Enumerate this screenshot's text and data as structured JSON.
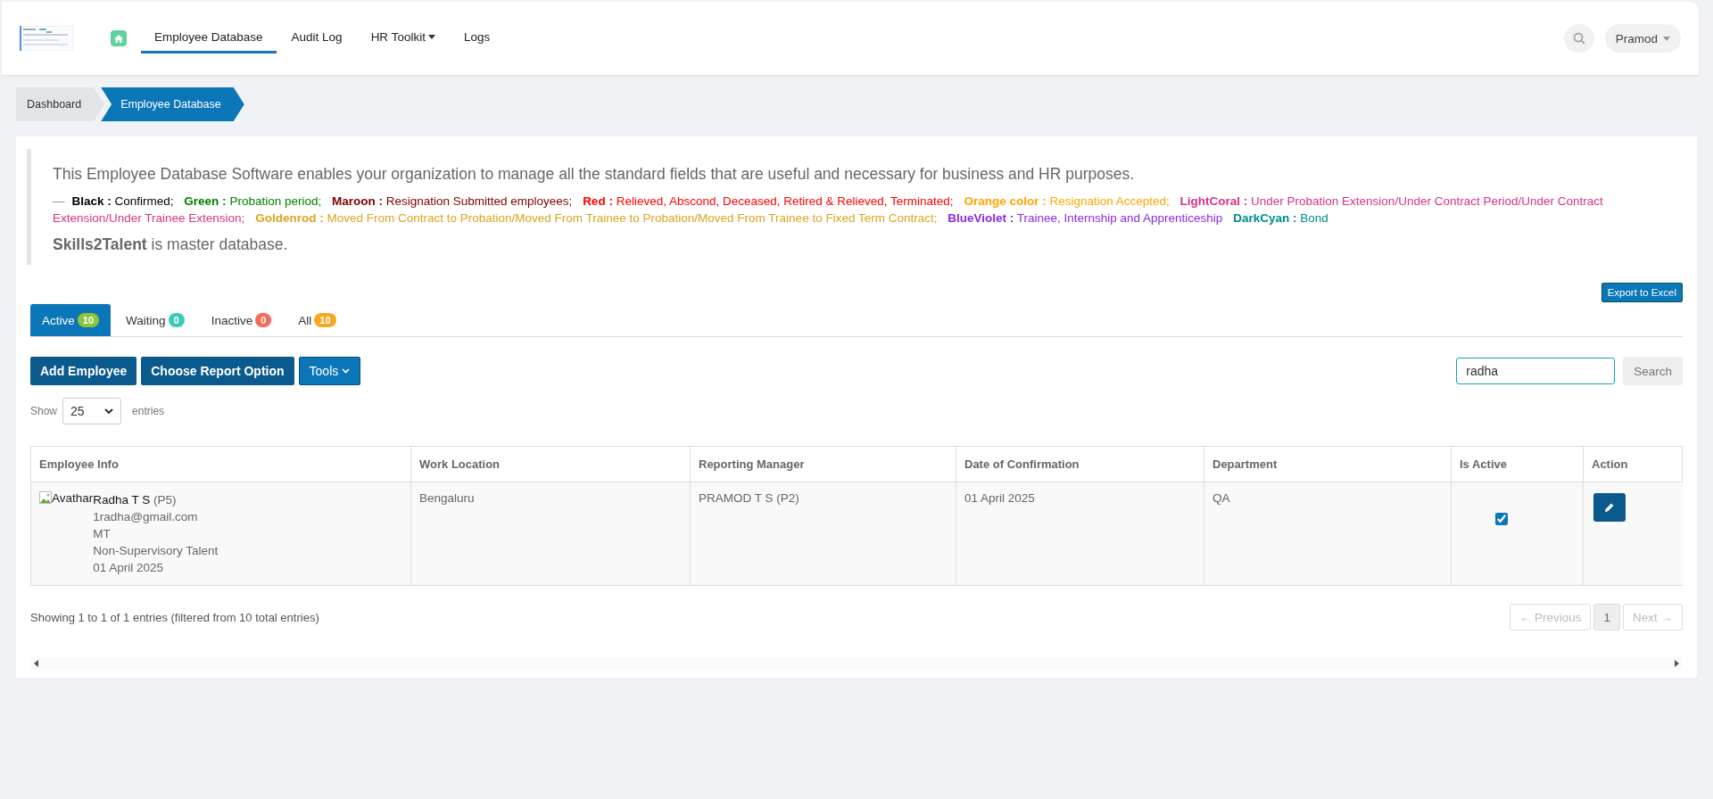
{
  "nav": {
    "items": [
      {
        "label": "Employee Database",
        "selected": true,
        "dropdown": false
      },
      {
        "label": "Audit Log",
        "selected": false,
        "dropdown": false
      },
      {
        "label": "HR Toolkit",
        "selected": false,
        "dropdown": true
      },
      {
        "label": "Logs",
        "selected": false,
        "dropdown": false
      }
    ],
    "user": "Pramod"
  },
  "breadcrumb": [
    {
      "label": "Dashboard",
      "selected": false
    },
    {
      "label": "Employee Database",
      "selected": true
    }
  ],
  "info": {
    "description": "This Employee Database Software enables your organization to manage all the standard fields that are useful and necessary for business and HR purposes.",
    "dash": "—",
    "legend": [
      {
        "label": "Black :",
        "text": "Confirmed;",
        "color": "#000000"
      },
      {
        "label": "Green :",
        "text": "Probation period;",
        "color": "#008000"
      },
      {
        "label": "Maroon :",
        "text": "Resignation Submitted employees;",
        "color": "#800000"
      },
      {
        "label": "Red :",
        "text": "Relieved, Abscond, Deceased, Retired & Relieved, Terminated;",
        "color": "#ff0000"
      },
      {
        "label": "Orange color :",
        "text": "Resignation Accepted;",
        "color": "#ffa500"
      },
      {
        "label": "LightCoral :",
        "text": "Under Probation Extension/Under Contract Period/Under Contract Extension/Under Trainee Extension;",
        "color": "#d63384"
      },
      {
        "label": "Goldenrod :",
        "text": "Moved From Contract to Probation/Moved From Trainee to Probation/Moved From Trainee to Fixed Term Contract;",
        "color": "#daa520"
      },
      {
        "label": "BlueViolet :",
        "text": "Trainee, Internship and Apprenticeship",
        "color": "#8a2be2"
      },
      {
        "label": "DarkCyan :",
        "text": "Bond",
        "color": "#008b8b"
      }
    ],
    "note": "**Skills2Talent** is master database."
  },
  "export_button": "Export to Excel",
  "tabs": [
    {
      "label": "Active",
      "count": "10",
      "color": "#8cc63f",
      "selected": true
    },
    {
      "label": "Waiting",
      "count": "0",
      "color": "#3cc9b8",
      "selected": false
    },
    {
      "label": "Inactive",
      "count": "0",
      "color": "#f96a5a",
      "selected": false
    },
    {
      "label": "All",
      "count": "10",
      "color": "#f7a823",
      "selected": false
    }
  ],
  "actions": [
    {
      "label": "Add Employee",
      "dropdown": false
    },
    {
      "label": "Choose Report Option",
      "dropdown": false
    },
    {
      "label": "Tools",
      "dropdown": true
    }
  ],
  "search": {
    "value": "radha",
    "button": "Search"
  },
  "length": {
    "before": "Show",
    "value": "25",
    "after": "entries"
  },
  "table": {
    "columns": [
      "Employee Info",
      "Work Location",
      "Reporting Manager",
      "Date of Confirmation",
      "Department",
      "Is Active",
      "Action"
    ],
    "rows": [
      {
        "avatar_alt": "Avathar",
        "name": "Radha T S",
        "grade": "(P5)",
        "details": [
          "1radha@gmail.com",
          "MT",
          "Non-Supervisory Talent",
          "01 April 2025"
        ],
        "work_location": "Bengaluru",
        "manager": "PRAMOD T S (P2)",
        "confirmation": "01 April 2025",
        "department": "QA",
        "is_active": true
      }
    ]
  },
  "summary": "Showing 1 to 1 of 1 entries (filtered from 10 total entries)",
  "pagination": {
    "previous": "← Previous",
    "pages": [
      {
        "label": "1",
        "selected": true
      }
    ],
    "next": "Next →"
  }
}
